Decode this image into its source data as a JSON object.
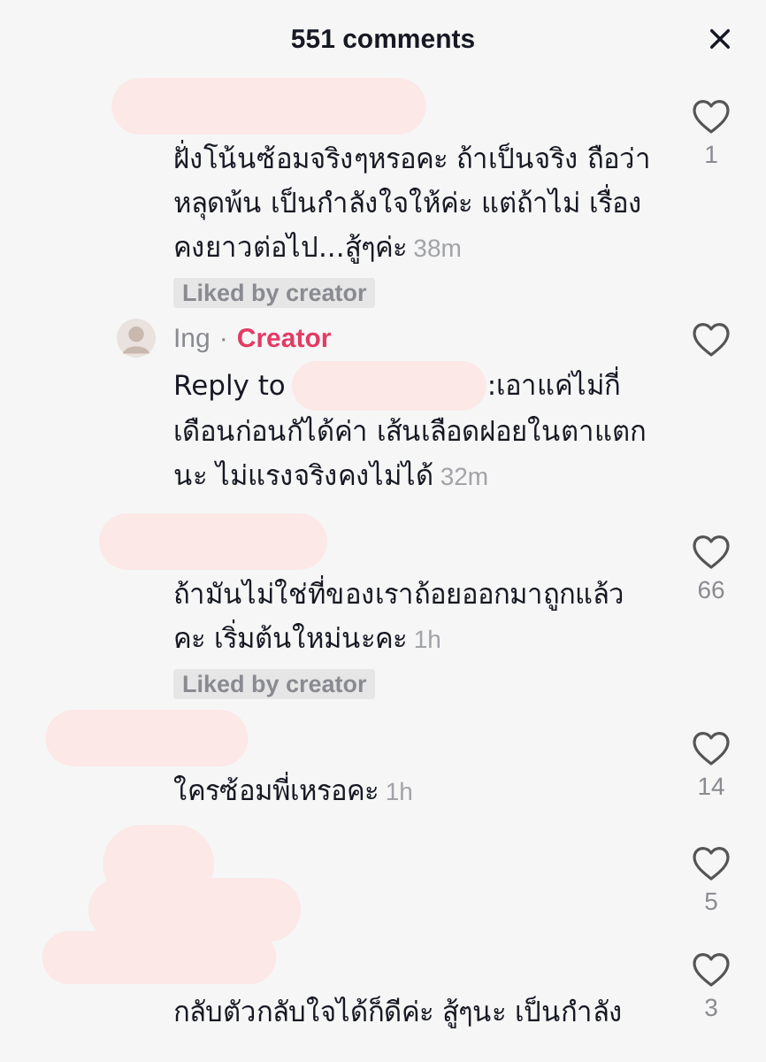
{
  "header": {
    "title": "551 comments"
  },
  "comments": [
    {
      "kind": "comment",
      "text": "ฝั่งโน้นซ้อมจริงๆหรอคะ ถ้าเป็นจริง ถือว่าหลุดพ้น เป็นกำลังใจให้ค่ะ แต่ถ้าไม่ เรื่องคงยาวต่อไป...สู้ๆค่ะ",
      "time": "38m",
      "likes": "1",
      "tag": "Liked by creator"
    },
    {
      "kind": "reply",
      "author": "Ing",
      "separator": "·",
      "badge": "Creator",
      "reply_prefix": "Reply to",
      "text": ":เอาแค่ไม่กี่",
      "text_continued": "เดือนก่อนกัได้ค่า เส้นเลือดฝอยในตาแตกนะ ไม่แรงจริงคงไม่ได้",
      "time": "32m"
    },
    {
      "kind": "comment",
      "text": "ถ้ามันไม่ใช่ที่ของเราถ้อยออกมาถูกแล้วคะ เริ่มต้นใหม่นะคะ",
      "time": "1h",
      "likes": "66",
      "tag": "Liked by creator"
    },
    {
      "kind": "comment",
      "text": "ใครซ้อมพี่เหรอคะ",
      "time": "1h",
      "likes": "14"
    },
    {
      "kind": "hidden",
      "likes": "5"
    },
    {
      "kind": "comment",
      "text": "กลับตัวกลับใจได้ก็ดีค่ะ สู้ๆนะ เป็นกำลัง",
      "likes": "3"
    }
  ]
}
